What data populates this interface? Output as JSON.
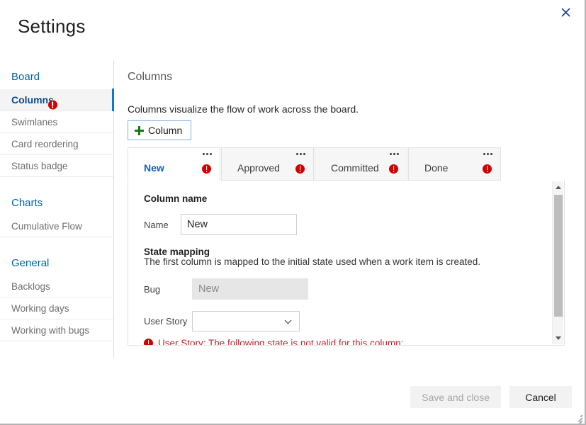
{
  "dialog": {
    "title": "Settings",
    "close_icon": "close-icon"
  },
  "sidebar": {
    "groups": [
      {
        "title": "Board",
        "items": [
          {
            "label": "Columns",
            "selected": true,
            "error": true
          },
          {
            "label": "Swimlanes",
            "selected": false,
            "error": false
          },
          {
            "label": "Card reordering",
            "selected": false,
            "error": false
          },
          {
            "label": "Status badge",
            "selected": false,
            "error": false
          }
        ]
      },
      {
        "title": "Charts",
        "items": [
          {
            "label": "Cumulative Flow",
            "selected": false,
            "error": false
          }
        ]
      },
      {
        "title": "General",
        "items": [
          {
            "label": "Backlogs",
            "selected": false,
            "error": false
          },
          {
            "label": "Working days",
            "selected": false,
            "error": false
          },
          {
            "label": "Working with bugs",
            "selected": false,
            "error": false
          }
        ]
      }
    ]
  },
  "main": {
    "section_title": "Columns",
    "description": "Columns visualize the flow of work across the board.",
    "add_column_label": "Column",
    "add_column_icon": "plus-icon",
    "tabs": [
      {
        "label": "New",
        "active": true,
        "error": true,
        "menu_icon": "ellipsis-icon"
      },
      {
        "label": "Approved",
        "active": false,
        "error": true,
        "menu_icon": "ellipsis-icon"
      },
      {
        "label": "Committed",
        "active": false,
        "error": true,
        "menu_icon": "ellipsis-icon"
      },
      {
        "label": "Done",
        "active": false,
        "error": true,
        "menu_icon": "ellipsis-icon"
      }
    ],
    "form": {
      "column_name_group": "Column name",
      "name_label": "Name",
      "name_value": "New",
      "name_placeholder": "",
      "state_mapping_group": "State mapping",
      "state_mapping_desc": "The first column is mapped to the initial state used when a work item is created.",
      "bug_label": "Bug",
      "bug_value": "New",
      "user_story_label": "User Story",
      "user_story_value": "",
      "user_story_options": [
        ""
      ],
      "error_message": "User Story: The following state is not valid for this column: ."
    }
  },
  "footer": {
    "save_label": "Save and close",
    "save_disabled": true,
    "cancel_label": "Cancel"
  },
  "colors": {
    "accent": "#0a7bd1",
    "link": "#0063b1",
    "error": "#d00000",
    "error_text": "#c1272d",
    "plus_green": "#127b12"
  }
}
